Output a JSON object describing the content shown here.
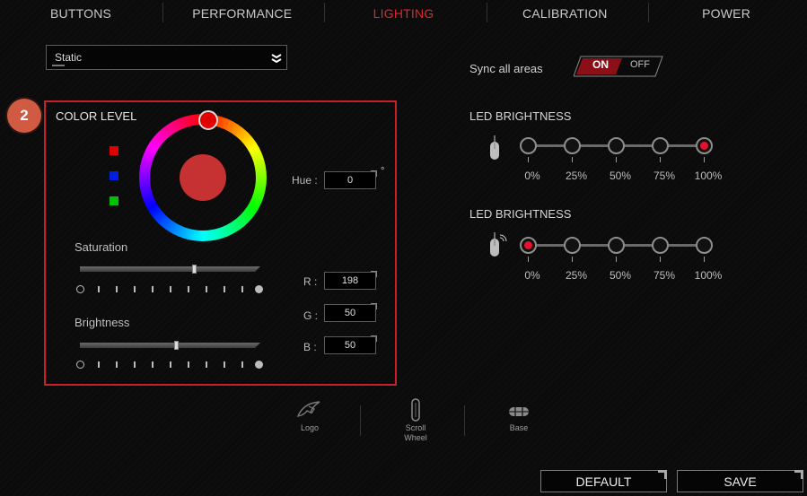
{
  "tabs": [
    {
      "label": "BUTTONS"
    },
    {
      "label": "PERFORMANCE"
    },
    {
      "label": "LIGHTING"
    },
    {
      "label": "CALIBRATION"
    },
    {
      "label": "POWER"
    }
  ],
  "active_tab": "LIGHTING",
  "effect_dropdown": {
    "value": "Static"
  },
  "sync": {
    "label": "Sync all areas",
    "on_label": "ON",
    "off_label": "OFF",
    "state": "ON"
  },
  "color_level": {
    "step_number": "2",
    "title": "COLOR LEVEL",
    "preset_swatches": [
      "#e00000",
      "#0020e0",
      "#00c000"
    ],
    "current_color": "#c63232",
    "hue_label": "Hue :",
    "hue_value": "0",
    "hue_unit": "°",
    "saturation_label": "Saturation",
    "saturation_level": 0.63,
    "brightness_label": "Brightness",
    "brightness_level": 0.53,
    "r_label": "R :",
    "r_value": "198",
    "g_label": "G :",
    "g_value": "50",
    "b_label": "B :",
    "b_value": "50"
  },
  "led_brightness": [
    {
      "title": "LED BRIGHTNESS",
      "levels": [
        "0%",
        "25%",
        "50%",
        "75%",
        "100%"
      ],
      "selected": "100%"
    },
    {
      "title": "LED BRIGHTNESS",
      "levels": [
        "0%",
        "25%",
        "50%",
        "75%",
        "100%"
      ],
      "selected": "0%"
    }
  ],
  "areas": [
    {
      "label": "Logo"
    },
    {
      "label": "Scroll\nWheel"
    },
    {
      "label": "Base"
    }
  ],
  "buttons": {
    "default_label": "DEFAULT",
    "save_label": "SAVE"
  },
  "colors": {
    "accent": "#e3242b",
    "panel_border": "#c8202a",
    "badge": "#d15a43"
  }
}
